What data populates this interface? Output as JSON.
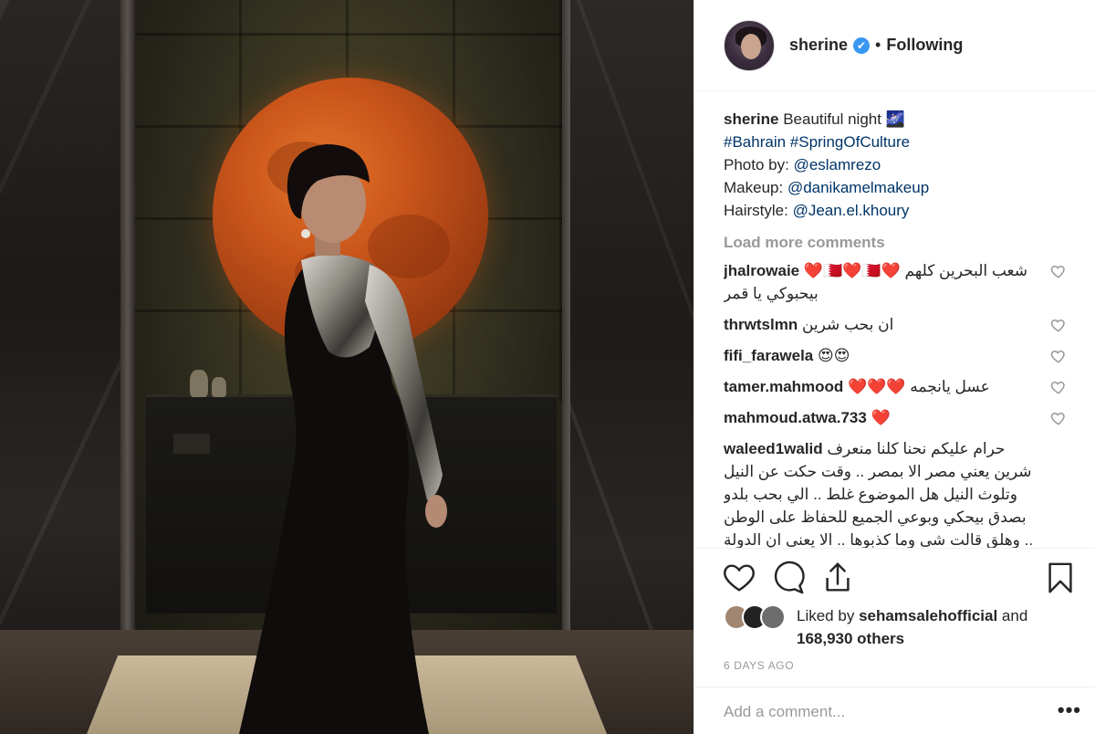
{
  "post": {
    "username": "sherine",
    "following_label": "Following",
    "dot": "•",
    "verified_icon": "✔"
  },
  "caption": {
    "username": "sherine",
    "text": "Beautiful night 🌌",
    "hashtags": "#Bahrain #SpringOfCulture",
    "photo_label": "Photo by:",
    "photo_handle": "@eslamrezo",
    "makeup_label": "Makeup:",
    "makeup_handle": "@danikamelmakeup",
    "hair_label": "Hairstyle:",
    "hair_handle": "@Jean.el.khoury"
  },
  "load_more": "Load more comments",
  "comments": [
    {
      "user": "jhalrowaie",
      "text": "شعب البحرين كلهم ❤️🇧🇭❤️🇧🇭❤️ بيحبوكي يا قمر"
    },
    {
      "user": "thrwtslmn",
      "text": "ان بحب شرين"
    },
    {
      "user": "fifi_farawela",
      "text": "😍😍"
    },
    {
      "user": "tamer.mahmood",
      "text": "عسل يانجمه ❤️❤️❤️"
    },
    {
      "user": "mahmoud.atwa.733",
      "text": "❤️"
    },
    {
      "user": "waleed1walid",
      "text": "حرام عليكم نحنا كلنا منعرف شرين يعني مصر الا بمصر .. وقت حكت عن النيل وتلوث النيل هل الموضوع غلط .. الي بحب بلدو بصدق بيحكي وبوعي الجميع للحفاظ على الوطن .. وهلق قالت شي وما كذبوها .. الا يعني ان الدولة"
    }
  ],
  "actions": {
    "like_icon": "heart-icon",
    "comment_icon": "comment-icon",
    "share_icon": "share-icon",
    "save_icon": "bookmark-icon"
  },
  "likes": {
    "prefix": "Liked by",
    "user": "sehamsalehofficial",
    "and": "and",
    "count": "168,930 others"
  },
  "timestamp": "6 DAYS AGO",
  "add_comment": {
    "placeholder": "Add a comment...",
    "more": "•••"
  },
  "colors": {
    "link": "#003569",
    "muted": "#999999",
    "verified": "#3897f0",
    "border": "#efefef"
  }
}
